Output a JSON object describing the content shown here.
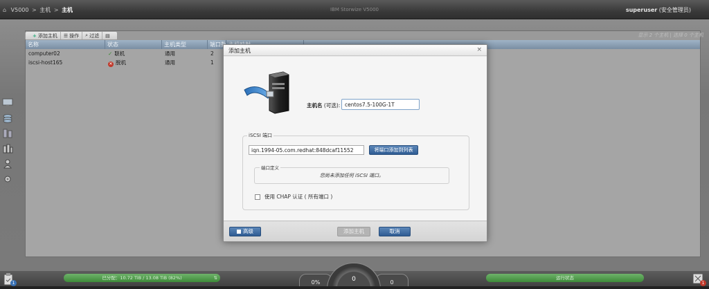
{
  "topbar": {
    "crumbs": [
      "V5000",
      "主机",
      "主机"
    ],
    "product": "IBM Storwize V5000",
    "user_name": "superuser",
    "user_role": "(安全管理员)"
  },
  "toolbar": {
    "add_host": "添加主机",
    "actions": "操作",
    "filter": "过滤"
  },
  "filter_info": "显示 2 个主机 | 选择 0 个主机",
  "grid": {
    "headers": [
      "名称",
      "状态",
      "主机类型",
      "端口数",
      "主机映射"
    ],
    "rows": [
      {
        "name": "computer02",
        "status": "联机",
        "type": "通用",
        "ports": "2"
      },
      {
        "name": "iscsi-host165",
        "status": "脱机",
        "type": "通用",
        "ports": "1"
      }
    ]
  },
  "modal": {
    "title": "添加主机",
    "close": "×",
    "host_label": "主机名",
    "host_optional": "(可选):",
    "host_value": "centos7.5-100G-1T",
    "iscsi_legend": "iSCSI 端口",
    "iqn_value": "iqn.1994-05.com.redhat:848dcaf11552",
    "add_port_button": "将端口添加到列表",
    "port_def_legend": "端口定义",
    "no_ports": "您尚未添加任何 iSCSI 端口。",
    "chap_label": "使用 CHAP 认证 ( 所有端口 )",
    "advanced_button": "高级",
    "add_host_button": "添加主机",
    "cancel_button": "取消"
  },
  "status": {
    "allocation": "已分配：10.72 TiB / 13.08 TiB (82%)",
    "gauge_left": "0%",
    "gauge_mid": "0",
    "gauge_right": "0",
    "health": "运行状态",
    "tasks_count": "1",
    "alerts_count": "1"
  },
  "colors": {
    "accent_blue": "#2f5c93",
    "ok_green": "#3a8a2e",
    "error_red": "#c0392b",
    "status_bar_green": "#4f9a4a"
  }
}
